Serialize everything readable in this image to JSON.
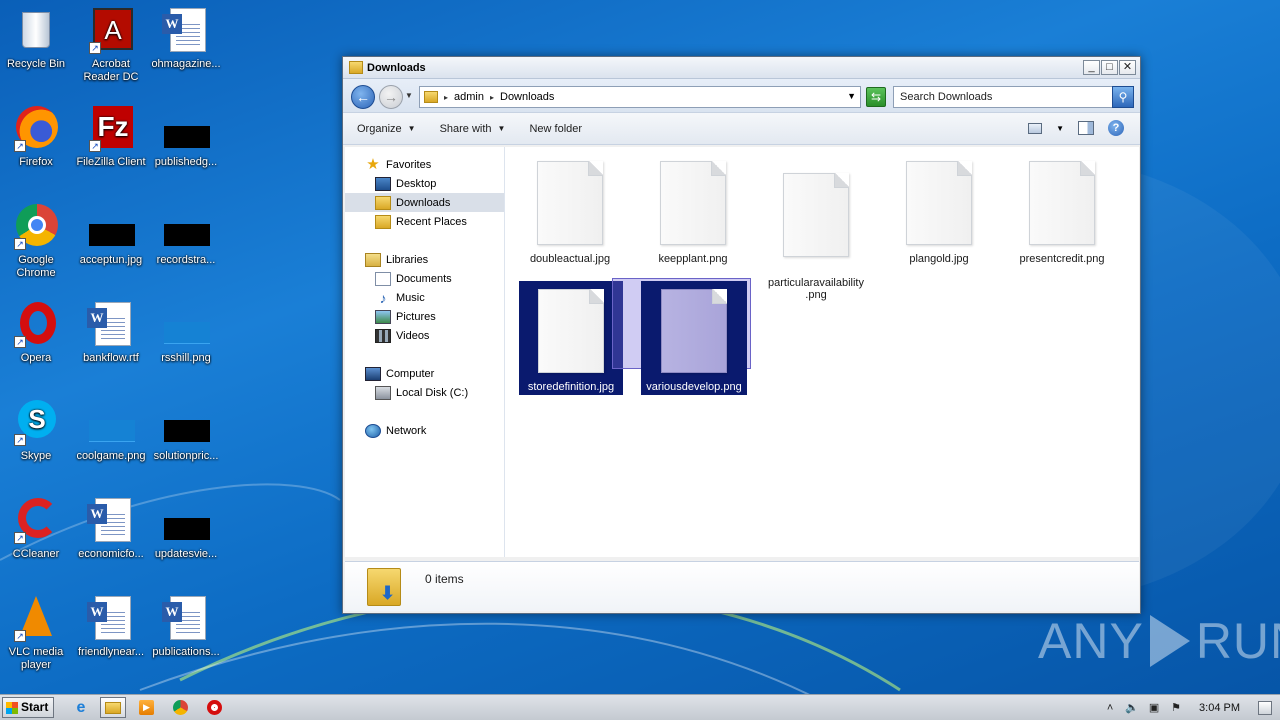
{
  "desktop": {
    "icons": [
      {
        "label": "Recycle Bin"
      },
      {
        "label": "Acrobat\nReader DC"
      },
      {
        "label": "ohmagazine..."
      },
      {
        "label": "Firefox"
      },
      {
        "label": "FileZilla Client"
      },
      {
        "label": "publishedg..."
      },
      {
        "label": "Google\nChrome"
      },
      {
        "label": "acceptun.jpg"
      },
      {
        "label": "recordstra..."
      },
      {
        "label": "Opera"
      },
      {
        "label": "bankflow.rtf"
      },
      {
        "label": "rsshill.png"
      },
      {
        "label": "Skype"
      },
      {
        "label": "coolgame.png"
      },
      {
        "label": "solutionpric..."
      },
      {
        "label": "CCleaner"
      },
      {
        "label": "economicfo..."
      },
      {
        "label": "updatesvie..."
      },
      {
        "label": "VLC media\nplayer"
      },
      {
        "label": "friendlynear..."
      },
      {
        "label": "publications..."
      }
    ]
  },
  "window": {
    "title": "Downloads",
    "breadcrumb": [
      "admin",
      "Downloads"
    ],
    "search_placeholder": "Search Downloads",
    "toolbar": {
      "organize": "Organize",
      "share_with": "Share with",
      "new_folder": "New folder"
    },
    "nav": {
      "favorites": "Favorites",
      "desktop": "Desktop",
      "downloads": "Downloads",
      "recent_places": "Recent Places",
      "libraries": "Libraries",
      "documents": "Documents",
      "music": "Music",
      "pictures": "Pictures",
      "videos": "Videos",
      "computer": "Computer",
      "local_disk": "Local Disk (C:)",
      "network": "Network"
    },
    "files": [
      {
        "name": "doubleactual.jpg"
      },
      {
        "name": "keepplant.png"
      },
      {
        "name": "particularavailability\n.png"
      },
      {
        "name": "plangold.jpg"
      },
      {
        "name": "presentcredit.png"
      },
      {
        "name": "storedefinition.jpg",
        "selected": true
      },
      {
        "name": "variousdevelop.png",
        "selected": true
      }
    ],
    "status": "0 items"
  },
  "taskbar": {
    "start": "Start",
    "clock": "3:04 PM"
  },
  "watermark": {
    "left": "ANY",
    "right": "RUN"
  }
}
